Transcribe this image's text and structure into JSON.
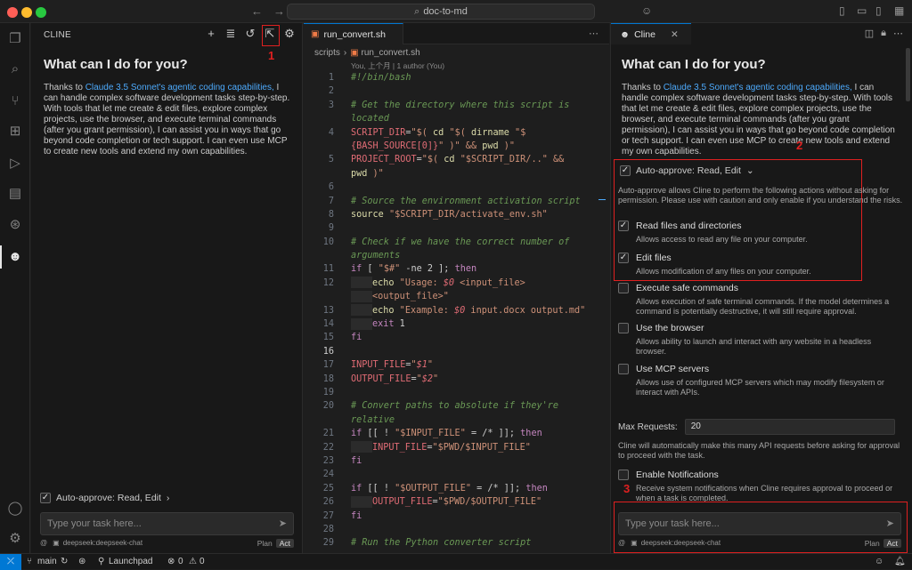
{
  "titlebar": {
    "back": "←",
    "forward": "→",
    "search_text": "doc-to-md",
    "copilot_icon": "copilot-icon",
    "layout_icons": [
      "layout-sidebar-left-icon",
      "layout-panel-icon",
      "layout-sidebar-right-icon",
      "layout-customize-icon"
    ]
  },
  "activity": {
    "items": [
      "explorer-icon",
      "search-icon",
      "source-control-icon",
      "extensions-icon",
      "run-debug-icon",
      "remote-explorer-icon",
      "git-graph-icon",
      "cline-icon"
    ],
    "bottom": [
      "account-icon",
      "settings-icon"
    ]
  },
  "left": {
    "header": "CLINE",
    "welcome_title": "What can I do for you?",
    "text_before_link": "Thanks to ",
    "link": "Claude 3.5 Sonnet's agentic coding capabilities,",
    "text_after_link": " I can handle complex software development tasks step-by-step. With tools that let me create & edit files, explore complex projects, use the browser, and execute terminal commands (after you grant permission), I can assist you in ways that go beyond code completion or tech support. I can even use MCP to create new tools and extend my own capabilities.",
    "auto_approve": "Auto-approve: Read, Edit",
    "task_placeholder": "Type your task here...",
    "model": "deepseek:deepseek-chat",
    "plan": "Plan",
    "act": "Act",
    "annotation": "1"
  },
  "editor": {
    "tab_label": "run_convert.sh",
    "breadcrumb_folder": "scripts",
    "breadcrumb_file": "run_convert.sh",
    "blame": "You, 上个月 | 1 author (You)",
    "lines": [
      {
        "n": "1",
        "cur": false,
        "parts": [
          {
            "c": "c-com",
            "t": "#!/bin/bash"
          }
        ]
      },
      {
        "n": "2",
        "cur": false,
        "parts": []
      },
      {
        "n": "3",
        "cur": false,
        "parts": [
          {
            "c": "c-com",
            "t": "# Get the directory where this script is"
          }
        ]
      },
      {
        "n": "",
        "cur": false,
        "parts": [
          {
            "c": "c-com",
            "t": "located"
          }
        ]
      },
      {
        "n": "4",
        "cur": false,
        "parts": [
          {
            "c": "c-var",
            "t": "SCRIPT_DIR"
          },
          {
            "c": "c-def",
            "t": "="
          },
          {
            "c": "c-str",
            "t": "\"$( "
          },
          {
            "c": "c-fn",
            "t": "cd"
          },
          {
            "c": "c-str",
            "t": " \"$( "
          },
          {
            "c": "c-fn",
            "t": "dirname"
          },
          {
            "c": "c-str",
            "t": " \"$"
          }
        ]
      },
      {
        "n": "",
        "cur": false,
        "parts": [
          {
            "c": "c-var",
            "t": "{BASH_SOURCE[0]}"
          },
          {
            "c": "c-str",
            "t": "\" )\" && "
          },
          {
            "c": "c-fn",
            "t": "pwd"
          },
          {
            "c": "c-str",
            "t": " )\""
          }
        ]
      },
      {
        "n": "5",
        "cur": false,
        "parts": [
          {
            "c": "c-var",
            "t": "PROJECT_ROOT"
          },
          {
            "c": "c-def",
            "t": "="
          },
          {
            "c": "c-str",
            "t": "\"$( "
          },
          {
            "c": "c-fn",
            "t": "cd"
          },
          {
            "c": "c-str",
            "t": " \"$SCRIPT_DIR/..\" &&"
          }
        ]
      },
      {
        "n": "",
        "cur": false,
        "parts": [
          {
            "c": "c-fn",
            "t": "pwd"
          },
          {
            "c": "c-str",
            "t": " )\""
          }
        ]
      },
      {
        "n": "6",
        "cur": false,
        "parts": []
      },
      {
        "n": "7",
        "cur": false,
        "parts": [
          {
            "c": "c-com",
            "t": "# Source the environment activation script"
          }
        ]
      },
      {
        "n": "8",
        "cur": false,
        "parts": [
          {
            "c": "c-fn",
            "t": "source"
          },
          {
            "c": "c-str",
            "t": " \"$SCRIPT_DIR/activate_env.sh\""
          }
        ]
      },
      {
        "n": "9",
        "cur": false,
        "parts": []
      },
      {
        "n": "10",
        "cur": false,
        "parts": [
          {
            "c": "c-com",
            "t": "# Check if we have the correct number of"
          }
        ]
      },
      {
        "n": "",
        "cur": false,
        "parts": [
          {
            "c": "c-com",
            "t": "arguments"
          }
        ]
      },
      {
        "n": "11",
        "cur": false,
        "parts": [
          {
            "c": "c-kw",
            "t": "if"
          },
          {
            "c": "c-def",
            "t": " [ "
          },
          {
            "c": "c-str",
            "t": "\"$#\""
          },
          {
            "c": "c-def",
            "t": " -ne 2 ]; "
          },
          {
            "c": "c-kw",
            "t": "then"
          }
        ]
      },
      {
        "n": "12",
        "cur": false,
        "ind": true,
        "parts": [
          {
            "c": "c-fn",
            "t": "echo"
          },
          {
            "c": "c-str",
            "t": " \"Usage: "
          },
          {
            "c": "c-iv",
            "t": "$0"
          },
          {
            "c": "c-str",
            "t": " <input_file>"
          }
        ]
      },
      {
        "n": "",
        "cur": false,
        "ind": true,
        "parts": [
          {
            "c": "c-str",
            "t": "<output_file>\""
          }
        ]
      },
      {
        "n": "13",
        "cur": false,
        "ind": true,
        "parts": [
          {
            "c": "c-fn",
            "t": "echo"
          },
          {
            "c": "c-str",
            "t": " \"Example: "
          },
          {
            "c": "c-iv",
            "t": "$0"
          },
          {
            "c": "c-str",
            "t": " input.docx output.md\""
          }
        ]
      },
      {
        "n": "14",
        "cur": false,
        "ind": true,
        "parts": [
          {
            "c": "c-kw",
            "t": "exit"
          },
          {
            "c": "c-def",
            "t": " 1"
          }
        ]
      },
      {
        "n": "15",
        "cur": false,
        "parts": [
          {
            "c": "c-kw",
            "t": "fi"
          }
        ]
      },
      {
        "n": "16",
        "cur": true,
        "parts": []
      },
      {
        "n": "17",
        "cur": false,
        "parts": [
          {
            "c": "c-var",
            "t": "INPUT_FILE"
          },
          {
            "c": "c-def",
            "t": "="
          },
          {
            "c": "c-str",
            "t": "\""
          },
          {
            "c": "c-iv",
            "t": "$1"
          },
          {
            "c": "c-str",
            "t": "\""
          }
        ]
      },
      {
        "n": "18",
        "cur": false,
        "parts": [
          {
            "c": "c-var",
            "t": "OUTPUT_FILE"
          },
          {
            "c": "c-def",
            "t": "="
          },
          {
            "c": "c-str",
            "t": "\""
          },
          {
            "c": "c-iv",
            "t": "$2"
          },
          {
            "c": "c-str",
            "t": "\""
          }
        ]
      },
      {
        "n": "19",
        "cur": false,
        "parts": []
      },
      {
        "n": "20",
        "cur": false,
        "parts": [
          {
            "c": "c-com",
            "t": "# Convert paths to absolute if they're"
          }
        ]
      },
      {
        "n": "",
        "cur": false,
        "parts": [
          {
            "c": "c-com",
            "t": "relative"
          }
        ]
      },
      {
        "n": "21",
        "cur": false,
        "parts": [
          {
            "c": "c-kw",
            "t": "if"
          },
          {
            "c": "c-def",
            "t": " [[ ! "
          },
          {
            "c": "c-str",
            "t": "\"$INPUT_FILE\""
          },
          {
            "c": "c-def",
            "t": " = /* ]]; "
          },
          {
            "c": "c-kw",
            "t": "then"
          }
        ]
      },
      {
        "n": "22",
        "cur": false,
        "ind": true,
        "parts": [
          {
            "c": "c-var",
            "t": "INPUT_FILE"
          },
          {
            "c": "c-def",
            "t": "="
          },
          {
            "c": "c-str",
            "t": "\"$PWD/$INPUT_FILE\""
          }
        ]
      },
      {
        "n": "23",
        "cur": false,
        "parts": [
          {
            "c": "c-kw",
            "t": "fi"
          }
        ]
      },
      {
        "n": "24",
        "cur": false,
        "parts": []
      },
      {
        "n": "25",
        "cur": false,
        "parts": [
          {
            "c": "c-kw",
            "t": "if"
          },
          {
            "c": "c-def",
            "t": " [[ ! "
          },
          {
            "c": "c-str",
            "t": "\"$OUTPUT_FILE\""
          },
          {
            "c": "c-def",
            "t": " = /* ]]; "
          },
          {
            "c": "c-kw",
            "t": "then"
          }
        ]
      },
      {
        "n": "26",
        "cur": false,
        "ind": true,
        "parts": [
          {
            "c": "c-var",
            "t": "OUTPUT_FILE"
          },
          {
            "c": "c-def",
            "t": "="
          },
          {
            "c": "c-str",
            "t": "\"$PWD/$OUTPUT_FILE\""
          }
        ]
      },
      {
        "n": "27",
        "cur": false,
        "parts": [
          {
            "c": "c-kw",
            "t": "fi"
          }
        ]
      },
      {
        "n": "28",
        "cur": false,
        "parts": []
      },
      {
        "n": "29",
        "cur": false,
        "parts": [
          {
            "c": "c-com",
            "t": "# Run the Python converter script"
          }
        ]
      }
    ]
  },
  "right": {
    "tab_label": "Cline",
    "welcome_title": "What can I do for you?",
    "text_before_link": "Thanks to ",
    "link": "Claude 3.5 Sonnet's agentic coding capabilities,",
    "text_after_link": " I can handle complex software development tasks step-by-step. With tools that let me create & edit files, explore complex projects, use the browser, and execute terminal commands (after you grant permission), I can assist you in ways that go beyond code completion or tech support. I can even use MCP to create new tools and extend my own capabilities.",
    "auto_approve": "Auto-approve: Read, Edit",
    "auto_approve_desc": "Auto-approve allows Cline to perform the following actions without asking for permission. Please use with caution and only enable if you understand the risks.",
    "options": [
      {
        "label": "Read files and directories",
        "desc": "Allows access to read any file on your computer.",
        "checked": true
      },
      {
        "label": "Edit files",
        "desc": "Allows modification of any files on your computer.",
        "checked": true
      },
      {
        "label": "Execute safe commands",
        "desc": "Allows execution of safe terminal commands. If the model determines a command is potentially destructive, it will still require approval.",
        "checked": false
      },
      {
        "label": "Use the browser",
        "desc": "Allows ability to launch and interact with any website in a headless browser.",
        "checked": false
      },
      {
        "label": "Use MCP servers",
        "desc": "Allows use of configured MCP servers which may modify filesystem or interact with APIs.",
        "checked": false
      }
    ],
    "max_requests_label": "Max Requests:",
    "max_requests_value": "20",
    "max_requests_desc": "Cline will automatically make this many API requests before asking for approval to proceed with the task.",
    "notifications_label": "Enable Notifications",
    "notifications_desc": "Receive system notifications when Cline requires approval to proceed or when a task is completed.",
    "task_placeholder": "Type your task here...",
    "model": "deepseek:deepseek-chat",
    "plan": "Plan",
    "act": "Act",
    "annotation_2": "2",
    "annotation_3": "3"
  },
  "statusbar": {
    "branch": "main",
    "launchpad": "Launchpad",
    "errors": "0",
    "warnings": "0"
  }
}
